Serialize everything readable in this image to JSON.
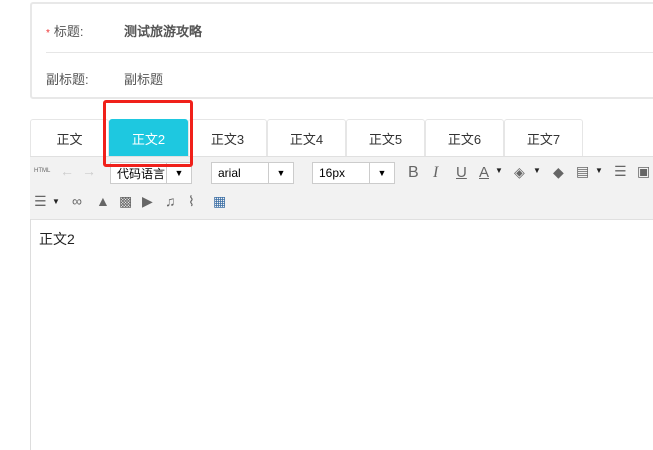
{
  "form": {
    "title_label": "标题:",
    "title_value": "测试旅游攻略",
    "required_mark": "*",
    "subtitle_label": "副标题:",
    "subtitle_value": "副标题"
  },
  "tabs": [
    "正文",
    "正文2",
    "正文3",
    "正文4",
    "正文5",
    "正文6",
    "正文7"
  ],
  "active_tab": 1,
  "toolbar": {
    "html_label": "HTML",
    "code_lang": "代码语言",
    "font_family": "arial",
    "font_size": "16px",
    "bold": "B",
    "italic": "I",
    "underline": "U",
    "font_color": "A"
  },
  "editor": {
    "content": "正文2"
  },
  "colors": {
    "accent": "#1ec8e0",
    "highlight": "#f0201a"
  }
}
